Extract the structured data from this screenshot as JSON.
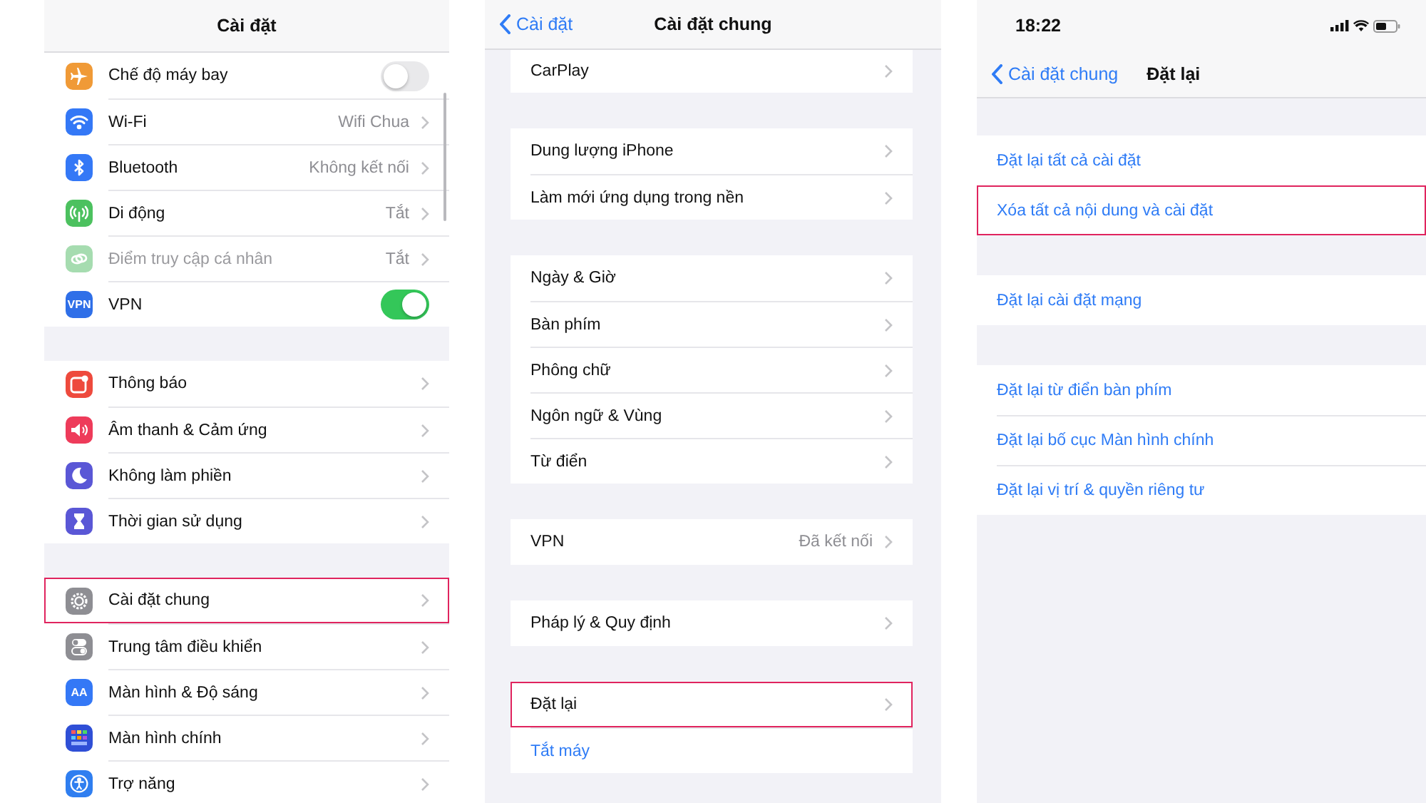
{
  "panels": [
    {
      "title": "Cài đặt",
      "groups": [
        [
          {
            "kind": "toggle",
            "label": "Chế độ máy bay",
            "on": false,
            "color": "#f09a37",
            "disabled": false,
            "highlighted": false
          },
          {
            "kind": "nav",
            "label": "Wi-Fi",
            "value": "Wifi Chua",
            "color": "#3478f6",
            "disabled": false,
            "highlighted": false
          },
          {
            "kind": "nav",
            "label": "Bluetooth",
            "value": "Không kết nối",
            "color": "#3478f6",
            "disabled": false,
            "highlighted": false
          },
          {
            "kind": "nav",
            "label": "Di động",
            "value": "Tắt",
            "color": "#4cc15f",
            "disabled": false,
            "highlighted": false
          },
          {
            "kind": "nav",
            "label": "Điểm truy cập cá nhân",
            "value": "Tắt",
            "color": "#a6dcb0",
            "disabled": true,
            "highlighted": false
          },
          {
            "kind": "toggle",
            "label": "VPN",
            "on": true,
            "color": "#2f6fe8",
            "icon_text": "VPN",
            "disabled": false,
            "highlighted": false
          }
        ],
        [
          {
            "kind": "nav",
            "label": "Thông báo",
            "color": "#ee4a3d",
            "highlighted": false
          },
          {
            "kind": "nav",
            "label": "Âm thanh & Cảm ứng",
            "color": "#ee3b5a",
            "highlighted": false
          },
          {
            "kind": "nav",
            "label": "Không làm phiền",
            "color": "#5a57d6",
            "highlighted": false
          },
          {
            "kind": "nav",
            "label": "Thời gian sử dụng",
            "color": "#5a57d6",
            "highlighted": false
          }
        ],
        [
          {
            "kind": "nav",
            "label": "Cài đặt chung",
            "color": "#8e8e93",
            "highlighted": true
          },
          {
            "kind": "nav",
            "label": "Trung tâm điều khiển",
            "color": "#8e8e93",
            "highlighted": false
          },
          {
            "kind": "nav",
            "label": "Màn hình & Độ sáng",
            "color": "#3478f6",
            "icon_text": "AA",
            "highlighted": false
          },
          {
            "kind": "nav",
            "label": "Màn hình chính",
            "color": "#2f4fd6",
            "highlighted": false
          },
          {
            "kind": "nav",
            "label": "Trợ năng",
            "color": "#2f7ef0",
            "highlighted": false
          }
        ]
      ]
    },
    {
      "back": "Cài đặt",
      "title": "Cài đặt chung",
      "groups": [
        [
          {
            "kind": "nav",
            "label": "CarPlay",
            "highlighted": false
          }
        ],
        [
          {
            "kind": "nav",
            "label": "Dung lượng iPhone",
            "highlighted": false
          },
          {
            "kind": "nav",
            "label": "Làm mới ứng dụng trong nền",
            "highlighted": false
          }
        ],
        [
          {
            "kind": "nav",
            "label": "Ngày & Giờ",
            "highlighted": false
          },
          {
            "kind": "nav",
            "label": "Bàn phím",
            "highlighted": false
          },
          {
            "kind": "nav",
            "label": "Phông chữ",
            "highlighted": false
          },
          {
            "kind": "nav",
            "label": "Ngôn ngữ & Vùng",
            "highlighted": false
          },
          {
            "kind": "nav",
            "label": "Từ điển",
            "highlighted": false
          }
        ],
        [
          {
            "kind": "nav",
            "label": "VPN",
            "value": "Đã kết nối",
            "highlighted": false
          }
        ],
        [
          {
            "kind": "nav",
            "label": "Pháp lý & Quy định",
            "highlighted": false
          }
        ],
        [
          {
            "kind": "nav",
            "label": "Đặt lại",
            "highlighted": true
          },
          {
            "kind": "action",
            "label": "Tắt máy",
            "highlighted": false
          }
        ]
      ]
    },
    {
      "time": "18:22",
      "back": "Cài đặt chung",
      "title": "Đặt lại",
      "groups": [
        [
          {
            "kind": "action",
            "label": "Đặt lại tất cả cài đặt",
            "highlighted": false
          },
          {
            "kind": "action",
            "label": "Xóa tất cả nội dung và cài đặt",
            "highlighted": true
          }
        ],
        [
          {
            "kind": "action",
            "label": "Đặt lại cài đặt mạng",
            "highlighted": false
          }
        ],
        [
          {
            "kind": "action",
            "label": "Đặt lại từ điển bàn phím",
            "highlighted": false
          },
          {
            "kind": "action",
            "label": "Đặt lại bố cục Màn hình chính",
            "highlighted": false
          },
          {
            "kind": "action",
            "label": "Đặt lại vị trí & quyền riêng tư",
            "highlighted": false
          }
        ]
      ]
    }
  ]
}
